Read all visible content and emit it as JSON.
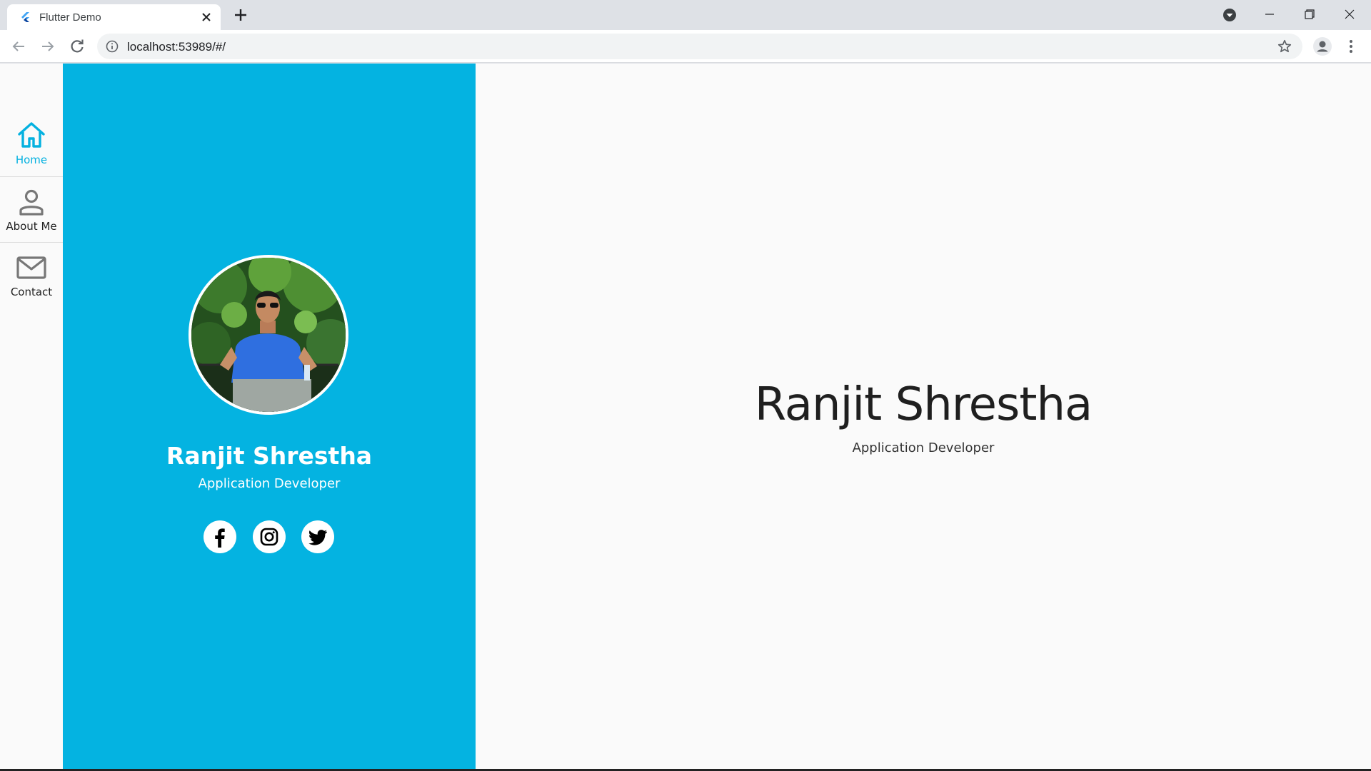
{
  "browser": {
    "tab": {
      "title": "Flutter Demo",
      "favicon": "flutter-logo-icon"
    },
    "address": {
      "url": "localhost:53989/#/"
    },
    "icons": [
      "flutter-logo-icon",
      "close-icon",
      "plus-icon",
      "media-control-icon",
      "minimize-icon",
      "restore-icon",
      "window-close-icon",
      "back-arrow-icon",
      "forward-arrow-icon",
      "reload-icon",
      "info-icon",
      "star-icon",
      "profile-icon",
      "kebab-menu-icon"
    ]
  },
  "nav": {
    "items": [
      {
        "label": "Home",
        "icon": "home-icon",
        "active": true
      },
      {
        "label": "About Me",
        "icon": "person-icon",
        "active": false
      },
      {
        "label": "Contact",
        "icon": "mail-icon",
        "active": false
      }
    ]
  },
  "profile": {
    "name": "Ranjit Shrestha",
    "role": "Application Developer",
    "social": [
      "facebook-icon",
      "instagram-icon",
      "twitter-icon"
    ]
  },
  "hero": {
    "name": "Ranjit Shrestha",
    "role": "Application Developer"
  },
  "colors": {
    "accent": "#04b3e1",
    "page_bg": "#fafafa",
    "chrome_bg": "#dee1e6",
    "text_dark": "#1f1f1f"
  }
}
